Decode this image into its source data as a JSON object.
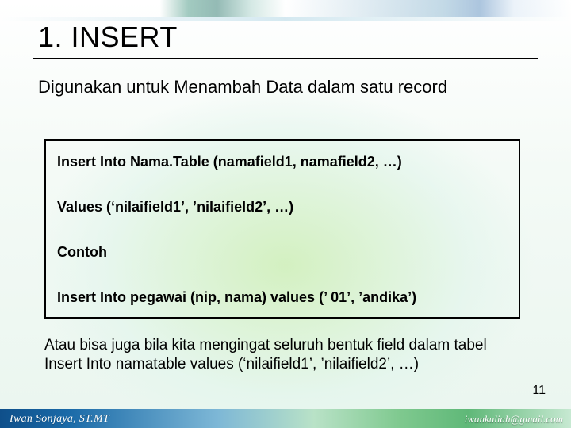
{
  "heading": "1.  INSERT",
  "intro": "Digunakan untuk Menambah Data dalam satu record",
  "codebox": {
    "line1": "Insert Into Nama.Table (namafield1, namafield2, …)",
    "line2": "Values (‘nilaifield1’, ’nilaifield2’, …)",
    "line3": "Contoh",
    "line4": "Insert Into pegawai (nip, nama) values (’ 01’, ’andika’)"
  },
  "outro_line1": "Atau bisa juga bila kita mengingat seluruh bentuk field dalam tabel",
  "outro_line2": "Insert Into namatable values (‘nilaifield1’, ’nilaifield2’, …)",
  "page_number": "11",
  "footer": {
    "author": "Iwan Sonjaya, ST.MT",
    "email": "iwankuliah@gmail.com"
  }
}
